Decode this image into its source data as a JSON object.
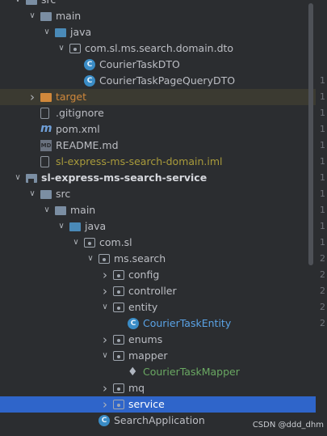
{
  "tree_rows": [
    {
      "label": "src",
      "chevron": "down",
      "icon": "folder-icon",
      "style": ""
    },
    {
      "label": "main",
      "chevron": "down",
      "icon": "folder-icon",
      "style": ""
    },
    {
      "label": "java",
      "chevron": "down",
      "icon": "source-folder-icon",
      "style": ""
    },
    {
      "label": "com.sl.ms.search.domain.dto",
      "chevron": "down",
      "icon": "package-icon",
      "style": ""
    },
    {
      "label": "CourierTaskDTO",
      "chevron": "",
      "icon": "class-icon",
      "style": ""
    },
    {
      "label": "CourierTaskPageQueryDTO",
      "chevron": "",
      "icon": "class-icon",
      "style": ""
    },
    {
      "label": "target",
      "chevron": "right",
      "icon": "target-folder-icon",
      "style": "orange"
    },
    {
      "label": ".gitignore",
      "chevron": "",
      "icon": "gitignore-icon",
      "style": ""
    },
    {
      "label": "pom.xml",
      "chevron": "",
      "icon": "maven-icon",
      "style": ""
    },
    {
      "label": "README.md",
      "chevron": "",
      "icon": "markdown-icon",
      "style": ""
    },
    {
      "label": "sl-express-ms-search-domain.iml",
      "chevron": "",
      "icon": "iml-icon",
      "style": "olive"
    },
    {
      "label": "sl-express-ms-search-service",
      "chevron": "down",
      "icon": "module-icon",
      "style": "bold"
    },
    {
      "label": "src",
      "chevron": "down",
      "icon": "folder-icon",
      "style": ""
    },
    {
      "label": "main",
      "chevron": "down",
      "icon": "folder-icon",
      "style": ""
    },
    {
      "label": "java",
      "chevron": "down",
      "icon": "source-folder-icon",
      "style": ""
    },
    {
      "label": "com.sl",
      "chevron": "down",
      "icon": "package-icon",
      "style": ""
    },
    {
      "label": "ms.search",
      "chevron": "down",
      "icon": "package-icon",
      "style": ""
    },
    {
      "label": "config",
      "chevron": "right",
      "icon": "package-icon",
      "style": ""
    },
    {
      "label": "controller",
      "chevron": "right",
      "icon": "package-icon",
      "style": ""
    },
    {
      "label": "entity",
      "chevron": "down",
      "icon": "package-icon",
      "style": ""
    },
    {
      "label": "CourierTaskEntity",
      "chevron": "",
      "icon": "class-icon",
      "style": "blue"
    },
    {
      "label": "enums",
      "chevron": "right",
      "icon": "package-icon",
      "style": ""
    },
    {
      "label": "mapper",
      "chevron": "down",
      "icon": "package-icon",
      "style": ""
    },
    {
      "label": "CourierTaskMapper",
      "chevron": "",
      "icon": "mybatis-icon",
      "style": "green"
    },
    {
      "label": "mq",
      "chevron": "right",
      "icon": "package-icon",
      "style": ""
    },
    {
      "label": "service",
      "chevron": "right",
      "icon": "package-icon",
      "style": ""
    },
    {
      "label": "SearchApplication",
      "chevron": "",
      "icon": "spring-class-icon",
      "style": ""
    }
  ],
  "gutter_numbers": [
    "1",
    "1",
    "1",
    "1",
    "1",
    "1",
    "1",
    "1",
    "1",
    "1",
    "1",
    "2",
    "2",
    "2",
    "2",
    "2"
  ],
  "watermark": "CSDN @ddd_dhm",
  "colors": {
    "background": "#2b2d30",
    "selection": "#2f65ca",
    "excluded": "#3b3a31",
    "accent_blue": "#5aa3e6"
  }
}
